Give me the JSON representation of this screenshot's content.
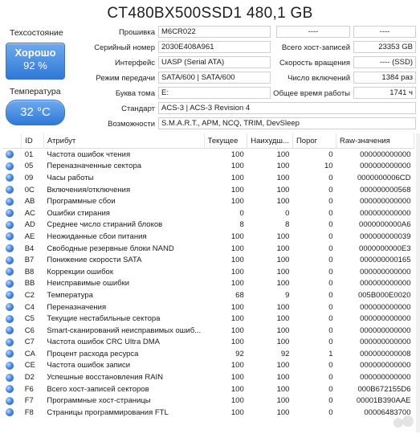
{
  "title": "CT480BX500SSD1 480,1 GB",
  "health": {
    "label": "Техсостояние",
    "status": "Хорошо",
    "percent": "92 %"
  },
  "temperature": {
    "label": "Температура",
    "value": "32 °C"
  },
  "info_left": [
    {
      "label": "Прошивка",
      "value": "M6CR022"
    },
    {
      "label": "Серийный номер",
      "value": "2030E408A961"
    },
    {
      "label": "Интерфейс",
      "value": "UASP (Serial ATA)"
    },
    {
      "label": "Режим передачи",
      "value": "SATA/600 | SATA/600"
    },
    {
      "label": "Буква тома",
      "value": "E:"
    }
  ],
  "info_right": [
    {
      "label": "----",
      "value": "----"
    },
    {
      "label": "Всего хост-записей",
      "value": "23353 GB"
    },
    {
      "label": "Скорость вращения",
      "value": "---- (SSD)"
    },
    {
      "label": "Число включений",
      "value": "1384 раз"
    },
    {
      "label": "Общее время работы",
      "value": "1741 ч"
    }
  ],
  "standard": {
    "label": "Стандарт",
    "value": "ACS-3 | ACS-3 Revision 4"
  },
  "features": {
    "label": "Возможности",
    "value": "S.M.A.R.T., APM, NCQ, TRIM, DevSleep"
  },
  "table": {
    "headers": [
      "ID",
      "Атрибут",
      "Текущее",
      "Наихудш...",
      "Порог",
      "Raw-значения"
    ],
    "rows": [
      [
        "01",
        "Частота ошибок чтения",
        "100",
        "100",
        "0",
        "000000000000"
      ],
      [
        "05",
        "Переназначенные сектора",
        "100",
        "100",
        "10",
        "000000000000"
      ],
      [
        "09",
        "Часы работы",
        "100",
        "100",
        "0",
        "0000000006CD"
      ],
      [
        "0C",
        "Включения/отключения",
        "100",
        "100",
        "0",
        "000000000568"
      ],
      [
        "AB",
        "Программные сбои",
        "100",
        "100",
        "0",
        "000000000000"
      ],
      [
        "AC",
        "Ошибки стирания",
        "0",
        "0",
        "0",
        "000000000000"
      ],
      [
        "AD",
        "Среднее число стираний блоков",
        "8",
        "8",
        "0",
        "0000000000A6"
      ],
      [
        "AE",
        "Неожиданные сбои питания",
        "100",
        "100",
        "0",
        "000000000039"
      ],
      [
        "B4",
        "Свободные резервные блоки NAND",
        "100",
        "100",
        "0",
        "0000000000E3"
      ],
      [
        "B7",
        "Понижение скорости SATA",
        "100",
        "100",
        "0",
        "000000000165"
      ],
      [
        "B8",
        "Коррекции ошибок",
        "100",
        "100",
        "0",
        "000000000000"
      ],
      [
        "BB",
        "Неисправимые ошибки",
        "100",
        "100",
        "0",
        "000000000000"
      ],
      [
        "C2",
        "Температура",
        "68",
        "9",
        "0",
        "005B000E0020"
      ],
      [
        "C4",
        "Переназначения",
        "100",
        "100",
        "0",
        "000000000000"
      ],
      [
        "C5",
        "Текущие нестабильные сектора",
        "100",
        "100",
        "0",
        "000000000000"
      ],
      [
        "C6",
        "Smart-сканирований неисправимых ошиб...",
        "100",
        "100",
        "0",
        "000000000000"
      ],
      [
        "C7",
        "Частота ошибок CRC Ultra DMA",
        "100",
        "100",
        "0",
        "000000000000"
      ],
      [
        "CA",
        "Процент расхода ресурса",
        "92",
        "92",
        "1",
        "000000000008"
      ],
      [
        "CE",
        "Частота ошибок записи",
        "100",
        "100",
        "0",
        "000000000000"
      ],
      [
        "D2",
        "Успешные восстановления RAIN",
        "100",
        "100",
        "0",
        "000000000000"
      ],
      [
        "F6",
        "Всего хост-записей секторов",
        "100",
        "100",
        "0",
        "000B672155D6"
      ],
      [
        "F7",
        "Программные хост-страницы",
        "100",
        "100",
        "0",
        "00001B390AAE"
      ],
      [
        "F8",
        "Страницы программирования FTL",
        "100",
        "100",
        "0",
        "00006483700"
      ]
    ]
  },
  "colors": {
    "accent": "#2f79d8",
    "status_dot": "#4a8ae6"
  }
}
